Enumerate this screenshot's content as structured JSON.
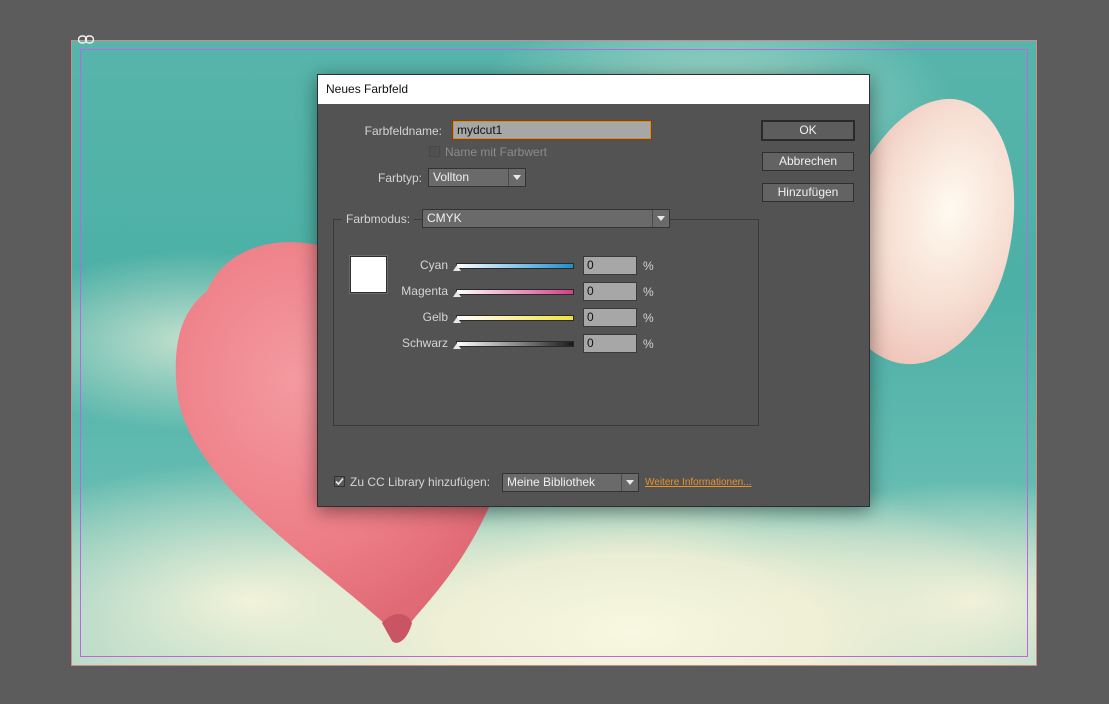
{
  "dialog": {
    "title": "Neues Farbfeld",
    "name_label": "Farbfeldname:",
    "name_value": "mydcut1",
    "name_with_value_label": "Name mit Farbwert",
    "type_label": "Farbtyp:",
    "type_value": "Vollton",
    "mode_label": "Farbmodus:",
    "mode_value": "CMYK",
    "channels": [
      {
        "label": "Cyan",
        "value": "0",
        "unit": "%",
        "track_color": "#1d8ed0"
      },
      {
        "label": "Magenta",
        "value": "0",
        "unit": "%",
        "track_color": "#d43f86"
      },
      {
        "label": "Gelb",
        "value": "0",
        "unit": "%",
        "track_color": "#f2e23a"
      },
      {
        "label": "Schwarz",
        "value": "0",
        "unit": "%",
        "track_color": "#1a1a1a"
      }
    ],
    "cc_label": "Zu CC Library hinzufügen:",
    "cc_value": "Meine Bibliothek",
    "more_info_link": "Weitere Informationen...",
    "buttons": {
      "ok": "OK",
      "cancel": "Abbrechen",
      "add": "Hinzufügen"
    }
  },
  "colors": {
    "swatch": "#ffffff",
    "focus_accent": "#e48a1b",
    "link": "#e8922a"
  },
  "icons": [
    "link-icon",
    "checkbox-check-icon",
    "chevron-down-icon"
  ]
}
